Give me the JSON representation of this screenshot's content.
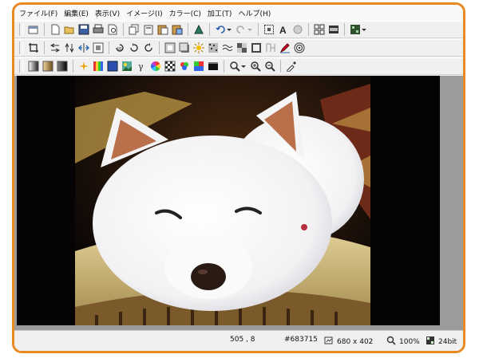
{
  "menu": [
    "ファイル(F)",
    "編集(E)",
    "表示(V)",
    "イメージ(I)",
    "カラー(C)",
    "加工(T)",
    "ヘルプ(H)"
  ],
  "toolbar1": {
    "icons": [
      "window-icon",
      "new-file-icon",
      "open-folder-icon",
      "save-icon",
      "print-icon",
      "print-preview-icon",
      "copy-icon",
      "copy-doc-icon",
      "paste-icon",
      "paste-new-icon",
      "select-stamp-icon",
      "undo-icon",
      "redo-icon",
      "select-rect-icon",
      "text-icon",
      "circle-brush-icon",
      "grid-icon",
      "filmstrip-icon",
      "view-mode-icon"
    ]
  },
  "toolbar2": {
    "icons": [
      "crop-icon",
      "flip-horizontal-icon",
      "flip-vertical-icon",
      "mirror-icon",
      "resize-icon",
      "rotate-90-icon",
      "rotate-ccw-icon",
      "rotate-cw-icon",
      "frame-icon",
      "shadow-icon",
      "brightness-icon",
      "noise-icon",
      "wave-icon",
      "mosaic-icon",
      "grayscale-icon",
      "edge-icon",
      "pen-icon",
      "vortex-icon"
    ]
  },
  "toolbar3": {
    "icons": [
      "gradient-gray-icon",
      "gradient-brown-icon",
      "gradient-dark-icon",
      "sparkle-icon",
      "color-bar-icon",
      "blue-square-icon",
      "palette-image-icon",
      "gamma-icon",
      "color-wheel-icon",
      "checker-icon",
      "rgb-dots-icon",
      "swatch-icon",
      "black-bar-icon",
      "zoom-menu-icon",
      "zoom-in-icon",
      "zoom-out-icon",
      "eyedropper-icon"
    ]
  },
  "status": {
    "coords": "505 , 8",
    "color": "#683715",
    "size": "680 x 402",
    "zoom": "100%",
    "depth": "24bit"
  }
}
